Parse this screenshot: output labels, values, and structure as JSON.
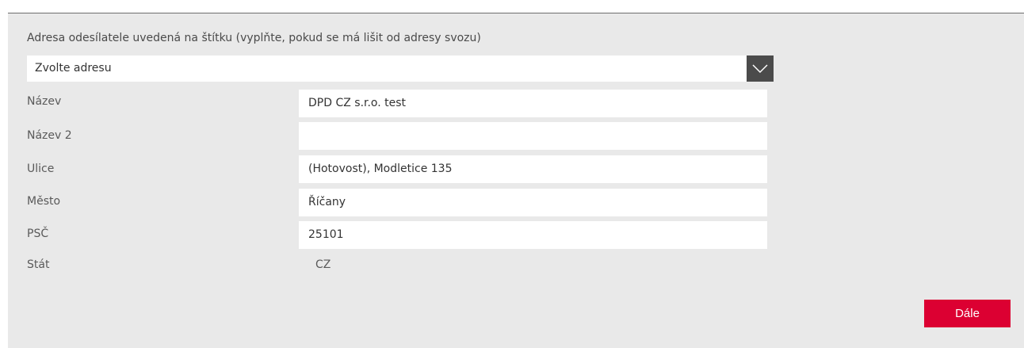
{
  "form": {
    "title": "Adresa odesílatele uvedená na štítku (vyplňte, pokud se má lišit od adresy svozu)",
    "address_select": {
      "value": "Zvolte adresu"
    },
    "fields": {
      "name": {
        "label": "Název",
        "value": "DPD CZ s.r.o. test"
      },
      "name2": {
        "label": "Název 2",
        "value": ""
      },
      "street": {
        "label": "Ulice",
        "value": "(Hotovost), Modletice 135"
      },
      "city": {
        "label": "Město",
        "value": "Říčany"
      },
      "zip": {
        "label": "PSČ",
        "value": "25101"
      },
      "country": {
        "label": "Stát",
        "value": "CZ"
      }
    },
    "next_label": "Dále"
  },
  "colors": {
    "panel_bg": "#e9e9e9",
    "accent": "#dc0032",
    "select_arrow_bg": "#4b4b4b"
  },
  "icons": {
    "select_arrow": "chevron-down-icon"
  }
}
